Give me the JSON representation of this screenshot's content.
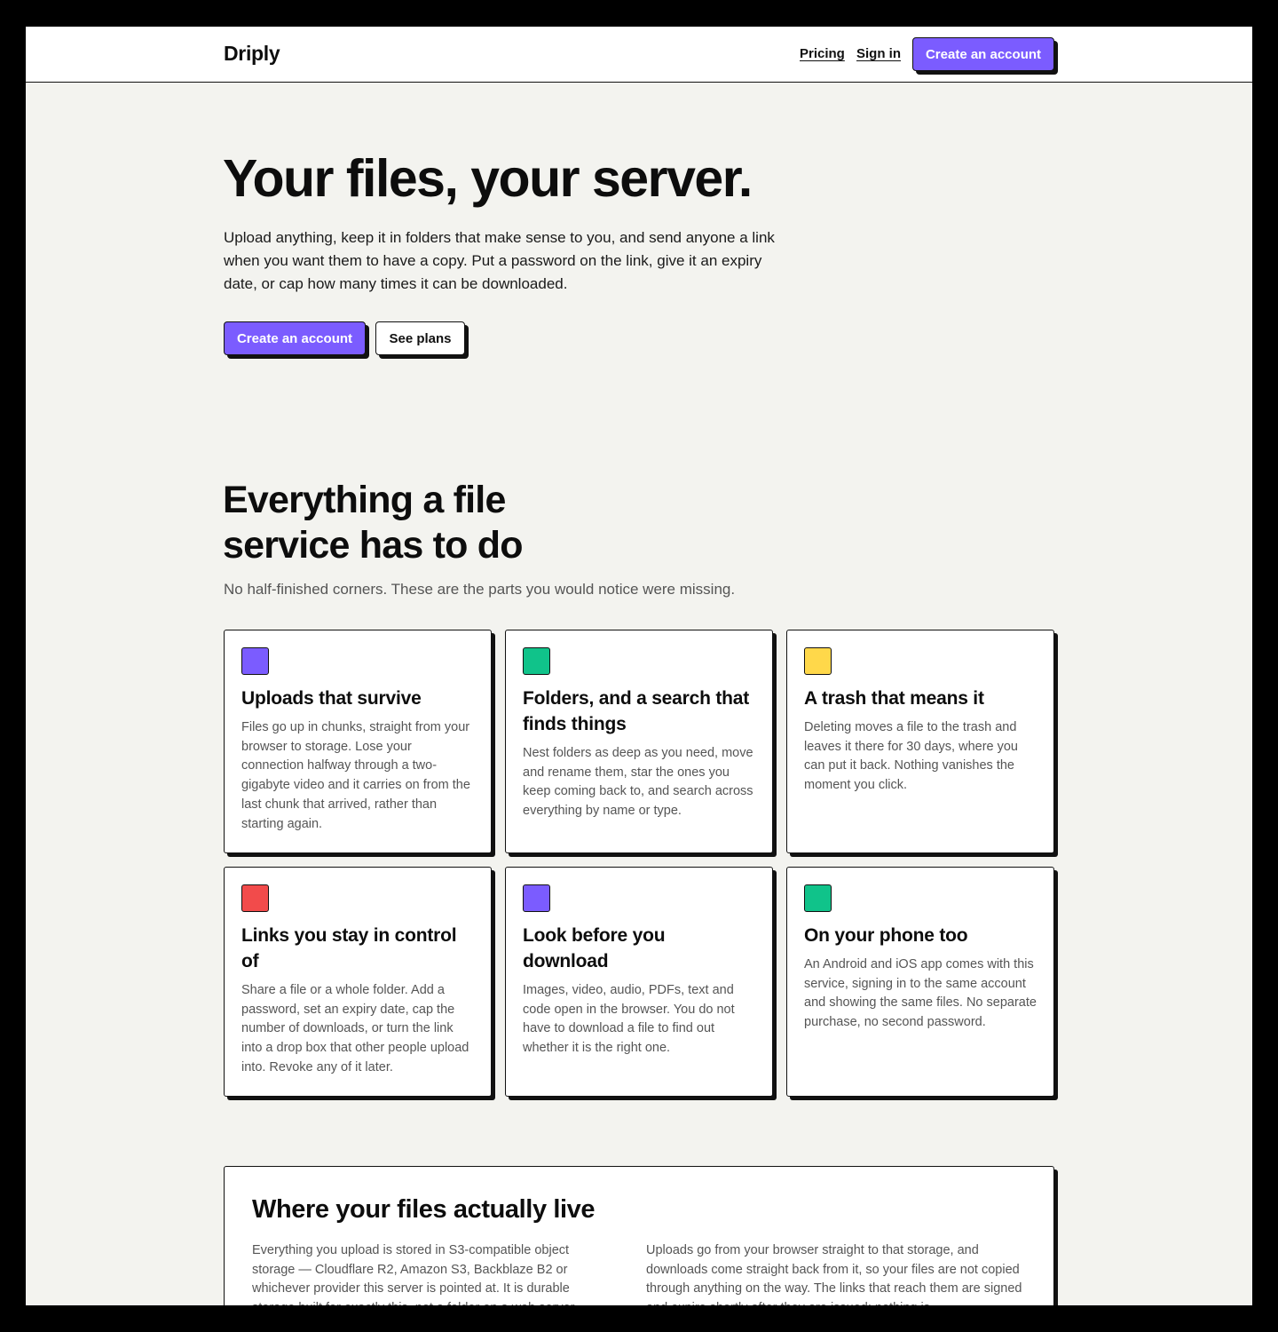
{
  "header": {
    "brand": "Driply",
    "nav": {
      "pricing": "Pricing",
      "sign_in": "Sign in",
      "cta": "Create an account"
    }
  },
  "hero": {
    "title": "Your files, your server.",
    "text": "Upload anything, keep it in folders that make sense to you, and send anyone a link when you want them to have a copy. Put a password on the link, give it an expiry date, or cap how many times it can be downloaded.",
    "primary_cta": "Create an account",
    "secondary_cta": "See plans"
  },
  "features": {
    "title": "Everything a file service has to do",
    "subtitle": "No half-finished corners. These are the parts you would notice were missing.",
    "cards": [
      {
        "color": "#7b5cff",
        "title": "Uploads that survive",
        "text": "Files go up in chunks, straight from your browser to storage. Lose your connection halfway through a two-gigabyte video and it carries on from the last chunk that arrived, rather than starting again."
      },
      {
        "color": "#10c38a",
        "title": "Folders, and a search that finds things",
        "text": "Nest folders as deep as you need, move and rename them, star the ones you keep coming back to, and search across everything by name or type."
      },
      {
        "color": "#ffd84a",
        "title": "A trash that means it",
        "text": "Deleting moves a file to the trash and leaves it there for 30 days, where you can put it back. Nothing vanishes the moment you click."
      },
      {
        "color": "#f24b4b",
        "title": "Links you stay in control of",
        "text": "Share a file or a whole folder. Add a password, set an expiry date, cap the number of downloads, or turn the link into a drop box that other people upload into. Revoke any of it later."
      },
      {
        "color": "#7b5cff",
        "title": "Look before you download",
        "text": "Images, video, audio, PDFs, text and code open in the browser. You do not have to download a file to find out whether it is the right one."
      },
      {
        "color": "#10c38a",
        "title": "On your phone too",
        "text": "An Android and iOS app comes with this service, signing in to the same account and showing the same files. No separate purchase, no second password."
      }
    ]
  },
  "storage": {
    "title": "Where your files actually live",
    "col1": "Everything you upload is stored in S3-compatible object storage — Cloudflare R2, Amazon S3, Backblaze B2 or whichever provider this server is pointed at. It is durable storage built for exactly this, not a folder on a web server.",
    "col2": "Uploads go from your browser straight to that storage, and downloads come straight back from it, so your files are not copied through anything on the way. The links that reach them are signed and expire shortly after they are issued; nothing is"
  }
}
